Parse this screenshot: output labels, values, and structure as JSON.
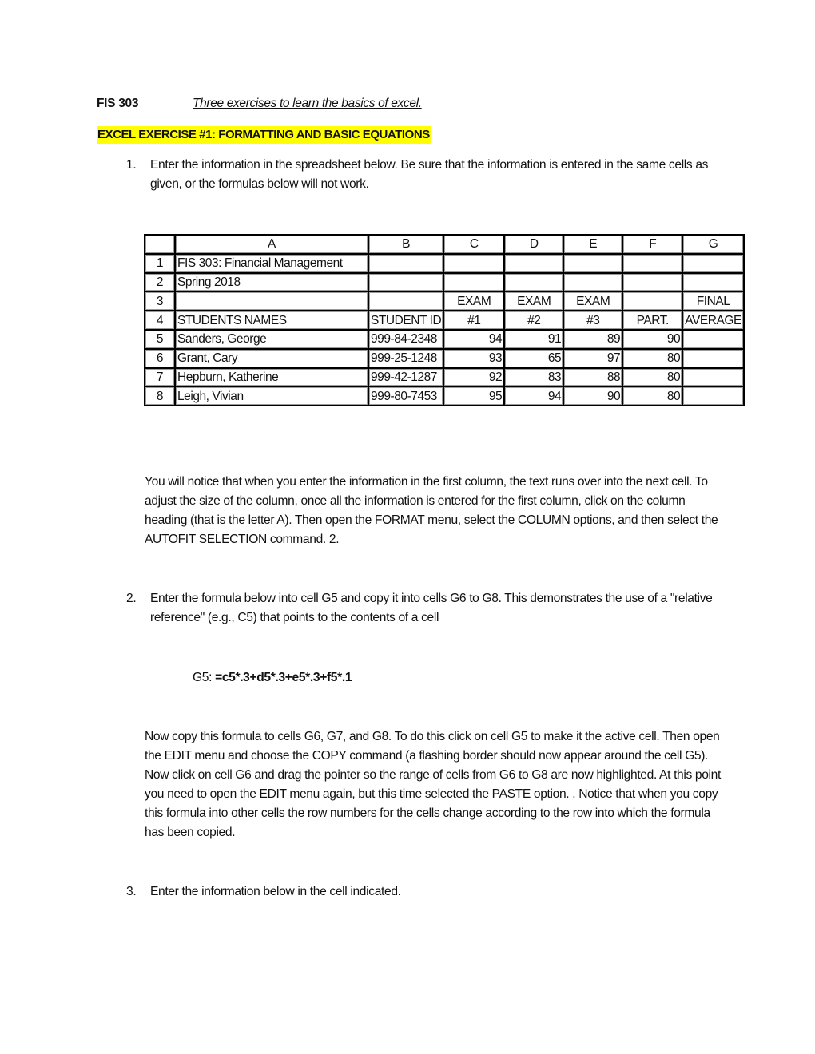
{
  "header": {
    "course": "FIS 303",
    "subtitle": "Three exercises to learn the basics of excel."
  },
  "exercise_title": "EXCEL EXERCISE #1: FORMATTING AND BASIC EQUATIONS",
  "step1": {
    "number": "1.",
    "text": "Enter the information in the spreadsheet below. Be sure that the information is entered in the same cells as given, or the formulas below will not work."
  },
  "spreadsheet": {
    "column_headers": [
      "",
      "A",
      "B",
      "C",
      "D",
      "E",
      "F",
      "G"
    ],
    "rows": [
      [
        "1",
        "FIS 303: Financial Management",
        "",
        "",
        "",
        "",
        "",
        ""
      ],
      [
        "2",
        "Spring 2018",
        "",
        "",
        "",
        "",
        "",
        ""
      ],
      [
        "3",
        "",
        "",
        "EXAM",
        "EXAM",
        "EXAM",
        "",
        "FINAL"
      ],
      [
        "4",
        "STUDENTS NAMES",
        "STUDENT ID",
        "#1",
        "#2",
        "#3",
        "PART.",
        "AVERAGE"
      ],
      [
        "5",
        "Sanders, George",
        "999-84-2348",
        "94",
        "91",
        "89",
        "90",
        ""
      ],
      [
        "6",
        "Grant, Cary",
        "999-25-1248",
        "93",
        "65",
        "97",
        "80",
        ""
      ],
      [
        "7",
        "Hepburn, Katherine",
        "999-42-1287",
        "92",
        "83",
        "88",
        "80",
        ""
      ],
      [
        "8",
        "Leigh, Vivian",
        "999-80-7453",
        "95",
        "94",
        "90",
        "80",
        ""
      ]
    ]
  },
  "autofit_note": "You will notice that when you enter the information in the first column, the text runs over into the next cell. To adjust the size of the column, once all the information is entered for the first column, click on the column heading (that is the letter A). Then open the FORMAT menu, select the COLUMN options, and then select the AUTOFIT SELECTION command. 2.",
  "step2": {
    "number": "2.",
    "text": "Enter the formula below into cell G5 and copy it into cells G6 to G8. This demonstrates the use of a \"relative reference\" (e.g., C5) that points to the contents of a cell"
  },
  "formula": {
    "cell_label": "G5: ",
    "expression": "=c5*.3+d5*.3+e5*.3+f5*.1"
  },
  "copy_instructions": "Now copy this formula to cells G6, G7, and G8. To do this click on cell G5 to make it the active cell. Then open the EDIT menu and choose the COPY command (a flashing border should now appear around the cell G5). Now click on cell G6 and drag the pointer so the range of cells from G6 to G8 are now highlighted. At this point you need to open the EDIT menu again, but this time selected the PASTE option. . Notice that when you copy this formula into other cells the row numbers for the cells change according to the row into which the formula has been copied.",
  "step3": {
    "number": "3.",
    "text": "Enter the information below in the cell indicated."
  }
}
